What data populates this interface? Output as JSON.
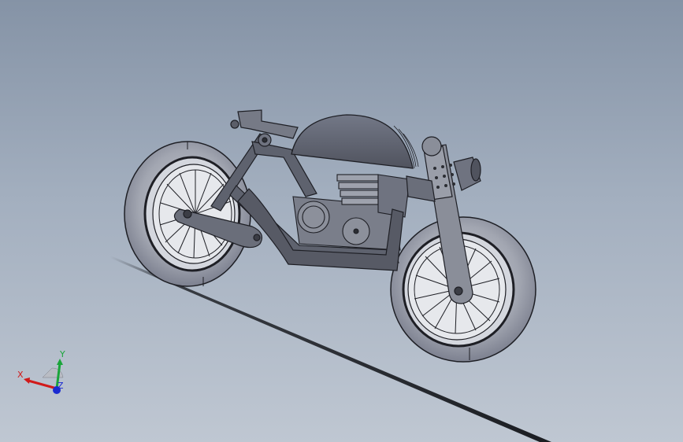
{
  "viewport": {
    "background_top": "#8593a6",
    "background_bottom": "#bfc7d2"
  },
  "model": {
    "subject": "motorcycle-assembly",
    "body_color": "#6f7380",
    "tire_color": "#9ea2ad",
    "frame_color": "#5e626e",
    "edge_color": "#1e1f25"
  },
  "triad": {
    "x_label": "X",
    "y_label": "Y",
    "z_label": "Z",
    "x_color": "#d11a1a",
    "y_color": "#1aa53a",
    "z_color": "#1a2ad1"
  }
}
